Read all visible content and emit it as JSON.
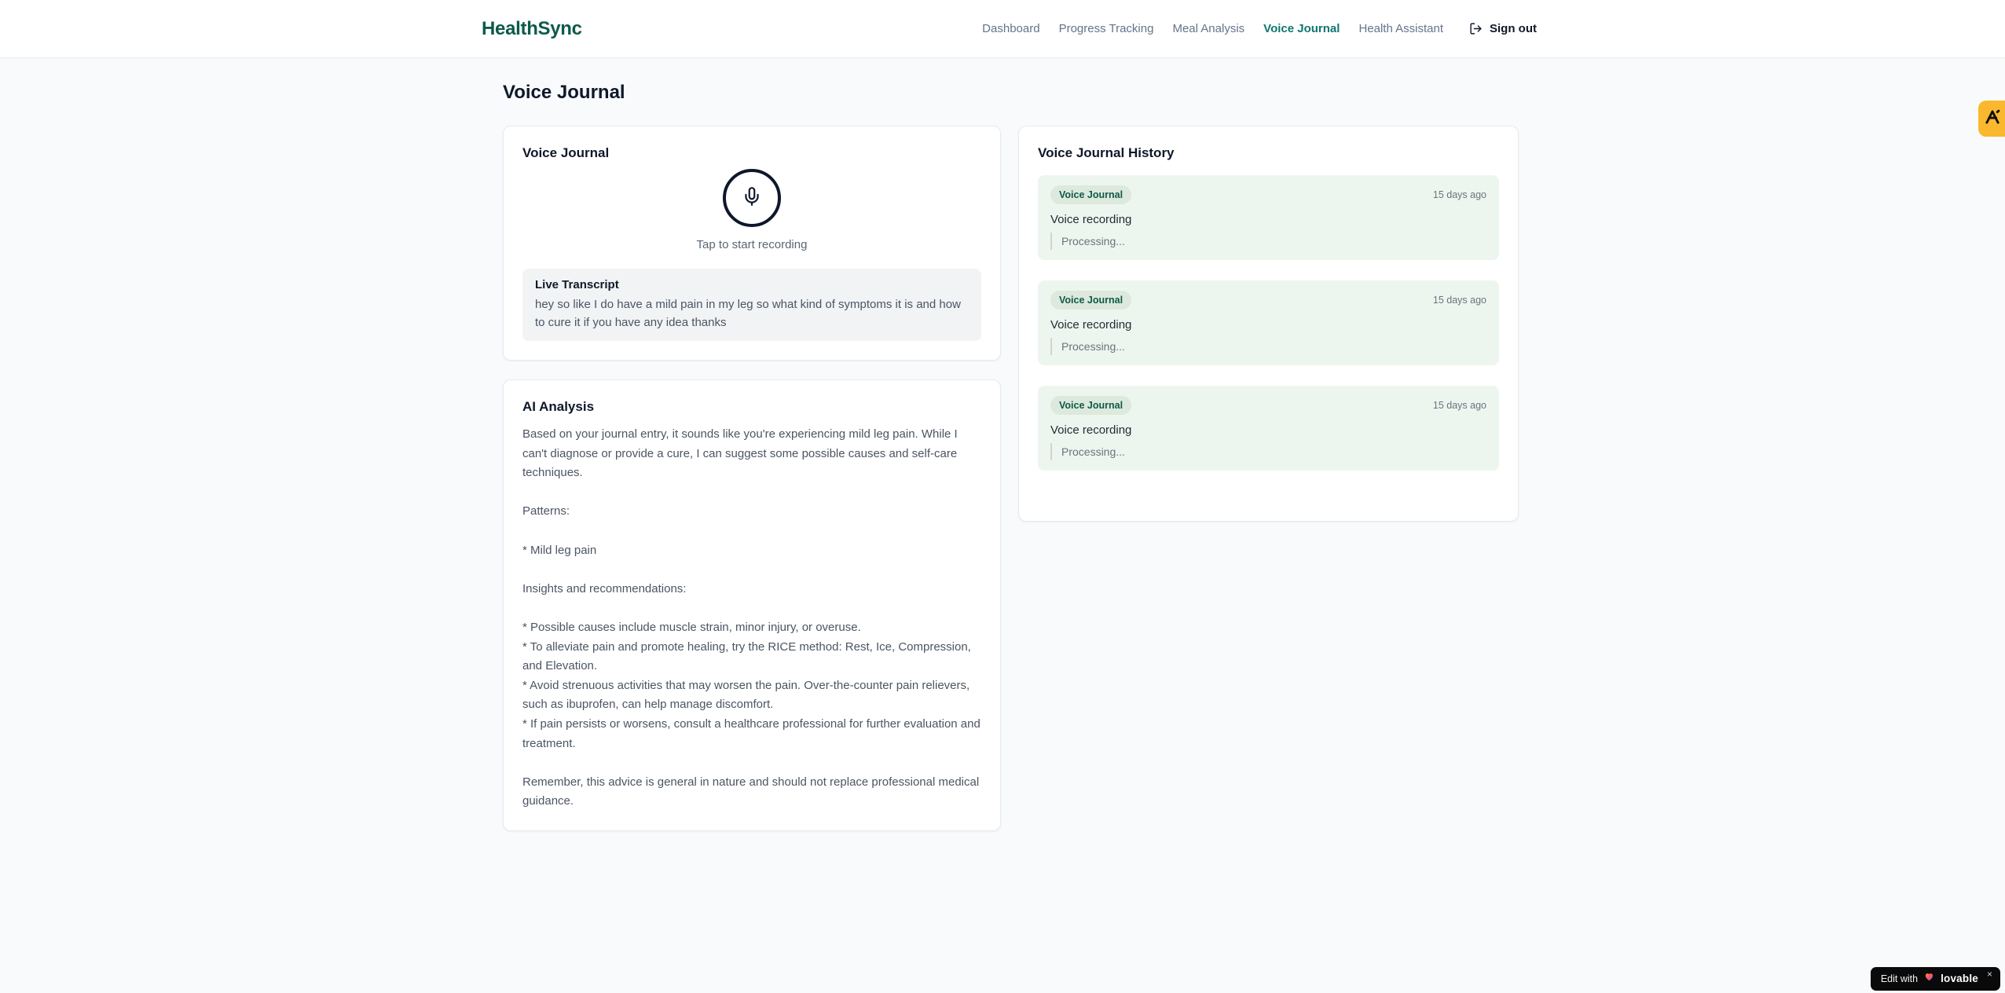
{
  "header": {
    "logo": "HealthSync",
    "nav": [
      {
        "label": "Dashboard",
        "active": false
      },
      {
        "label": "Progress Tracking",
        "active": false
      },
      {
        "label": "Meal Analysis",
        "active": false
      },
      {
        "label": "Voice Journal",
        "active": true
      },
      {
        "label": "Health Assistant",
        "active": false
      }
    ],
    "signout_label": "Sign out"
  },
  "page": {
    "title": "Voice Journal"
  },
  "recorder_card": {
    "title": "Voice Journal",
    "tap_hint": "Tap to start recording",
    "transcript_title": "Live Transcript",
    "transcript_text": "hey so like I do have a mild pain in my leg so what kind of symptoms it is and how to cure it if you have any idea thanks"
  },
  "analysis_card": {
    "title": "AI Analysis",
    "body": "Based on your journal entry, it sounds like you're experiencing mild leg pain. While I can't diagnose or provide a cure, I can suggest some possible causes and self-care techniques.\n\nPatterns:\n\n* Mild leg pain\n\nInsights and recommendations:\n\n* Possible causes include muscle strain, minor injury, or overuse.\n* To alleviate pain and promote healing, try the RICE method: Rest, Ice, Compression, and Elevation.\n* Avoid strenuous activities that may worsen the pain. Over-the-counter pain relievers, such as ibuprofen, can help manage discomfort.\n* If pain persists or worsens, consult a healthcare professional for further evaluation and treatment.\n\nRemember, this advice is general in nature and should not replace professional medical guidance."
  },
  "history_card": {
    "title": "Voice Journal History",
    "entries": [
      {
        "badge": "Voice Journal",
        "time": "15 days ago",
        "title": "Voice recording",
        "status": "Processing..."
      },
      {
        "badge": "Voice Journal",
        "time": "15 days ago",
        "title": "Voice recording",
        "status": "Processing..."
      },
      {
        "badge": "Voice Journal",
        "time": "15 days ago",
        "title": "Voice recording",
        "status": "Processing..."
      }
    ]
  },
  "widgets": {
    "lovable": {
      "prefix": "Edit with",
      "brand": "lovable",
      "close": "×"
    }
  },
  "icons": {
    "mic": "mic-icon",
    "signout": "logout-icon",
    "heart": "heart-icon",
    "side_logo": "lambda-logo-icon"
  },
  "colors": {
    "brand_teal": "#0c5a4b",
    "active_nav": "#0f766e",
    "page_bg": "#f8fafc",
    "entry_bg": "#edf6ee",
    "badge_bg": "#dce9dc",
    "badge_text": "#0f5a4a",
    "side_badge_amber": "#f9b82e"
  }
}
